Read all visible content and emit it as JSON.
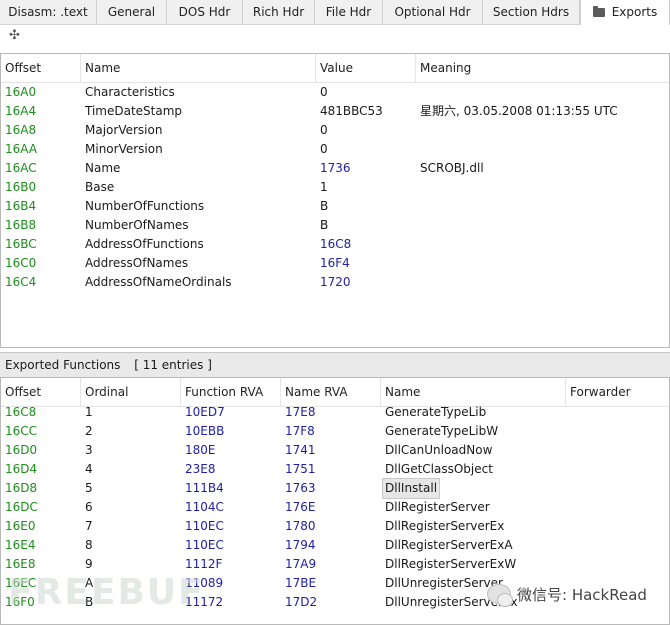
{
  "tabs": [
    {
      "label": "Disasm: .text"
    },
    {
      "label": "General"
    },
    {
      "label": "DOS Hdr"
    },
    {
      "label": "Rich Hdr"
    },
    {
      "label": "File Hdr"
    },
    {
      "label": "Optional Hdr"
    },
    {
      "label": "Section Hdrs"
    },
    {
      "label": "Exports"
    }
  ],
  "toolbar": {
    "move_icon": "move-icon"
  },
  "export_dir": {
    "columns": [
      "Offset",
      "Name",
      "Value",
      "Meaning"
    ],
    "rows": [
      {
        "offset": "16A0",
        "name": "Characteristics",
        "value": "0",
        "meaning": ""
      },
      {
        "offset": "16A4",
        "name": "TimeDateStamp",
        "value": "481BBC53",
        "meaning": "星期六, 03.05.2008 01:13:55 UTC"
      },
      {
        "offset": "16A8",
        "name": "MajorVersion",
        "value": "0",
        "meaning": ""
      },
      {
        "offset": "16AA",
        "name": "MinorVersion",
        "value": "0",
        "meaning": ""
      },
      {
        "offset": "16AC",
        "name": "Name",
        "value": "1736",
        "meaning": "SCROBJ.dll"
      },
      {
        "offset": "16B0",
        "name": "Base",
        "value": "1",
        "meaning": ""
      },
      {
        "offset": "16B4",
        "name": "NumberOfFunctions",
        "value": "B",
        "meaning": ""
      },
      {
        "offset": "16B8",
        "name": "NumberOfNames",
        "value": "B",
        "meaning": ""
      },
      {
        "offset": "16BC",
        "name": "AddressOfFunctions",
        "value": "16C8",
        "meaning": ""
      },
      {
        "offset": "16C0",
        "name": "AddressOfNames",
        "value": "16F4",
        "meaning": ""
      },
      {
        "offset": "16C4",
        "name": "AddressOfNameOrdinals",
        "value": "1720",
        "meaning": ""
      }
    ]
  },
  "exported": {
    "title": "Exported Functions",
    "count": "[ 11 entries ]",
    "columns": [
      "Offset",
      "Ordinal",
      "Function RVA",
      "Name RVA",
      "Name",
      "Forwarder"
    ],
    "rows": [
      {
        "offset": "16C8",
        "ordinal": "1",
        "func_rva": "10ED7",
        "name_rva": "17E8",
        "name": "GenerateTypeLib",
        "forwarder": ""
      },
      {
        "offset": "16CC",
        "ordinal": "2",
        "func_rva": "10EBB",
        "name_rva": "17F8",
        "name": "GenerateTypeLibW",
        "forwarder": ""
      },
      {
        "offset": "16D0",
        "ordinal": "3",
        "func_rva": "180E",
        "name_rva": "1741",
        "name": "DllCanUnloadNow",
        "forwarder": ""
      },
      {
        "offset": "16D4",
        "ordinal": "4",
        "func_rva": "23E8",
        "name_rva": "1751",
        "name": "DllGetClassObject",
        "forwarder": ""
      },
      {
        "offset": "16D8",
        "ordinal": "5",
        "func_rva": "111B4",
        "name_rva": "1763",
        "name": "DllInstall",
        "forwarder": ""
      },
      {
        "offset": "16DC",
        "ordinal": "6",
        "func_rva": "1104C",
        "name_rva": "176E",
        "name": "DllRegisterServer",
        "forwarder": ""
      },
      {
        "offset": "16E0",
        "ordinal": "7",
        "func_rva": "110EC",
        "name_rva": "1780",
        "name": "DllRegisterServerEx",
        "forwarder": ""
      },
      {
        "offset": "16E4",
        "ordinal": "8",
        "func_rva": "110EC",
        "name_rva": "1794",
        "name": "DllRegisterServerExA",
        "forwarder": ""
      },
      {
        "offset": "16E8",
        "ordinal": "9",
        "func_rva": "1112F",
        "name_rva": "17A9",
        "name": "DllRegisterServerExW",
        "forwarder": ""
      },
      {
        "offset": "16EC",
        "ordinal": "A",
        "func_rva": "11089",
        "name_rva": "17BE",
        "name": "DllUnregisterServer",
        "forwarder": ""
      },
      {
        "offset": "16F0",
        "ordinal": "B",
        "func_rva": "11172",
        "name_rva": "17D2",
        "name": "DllUnregisterServerEx",
        "forwarder": ""
      }
    ],
    "selected_name": "DllInstall"
  },
  "watermark": {
    "text": "FREEBUF",
    "wechat": "微信号: HackRead"
  }
}
